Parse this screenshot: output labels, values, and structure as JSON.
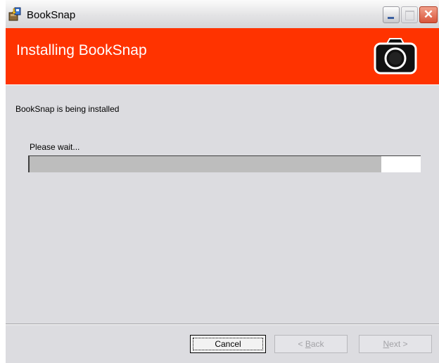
{
  "window": {
    "title": "BookSnap"
  },
  "banner": {
    "title": "Installing BookSnap",
    "background": "#ff3300"
  },
  "status": {
    "message": "BookSnap is being installed"
  },
  "progress": {
    "label": "Please wait...",
    "value_percent": 90
  },
  "buttons": {
    "cancel": "Cancel",
    "back": {
      "mnemonic": "B",
      "rest": "ack",
      "prefix": "< "
    },
    "next": {
      "mnemonic": "N",
      "rest": "ext",
      "suffix": " >"
    }
  },
  "icons": {
    "app": "installer-package-icon",
    "banner": "camera-icon"
  }
}
